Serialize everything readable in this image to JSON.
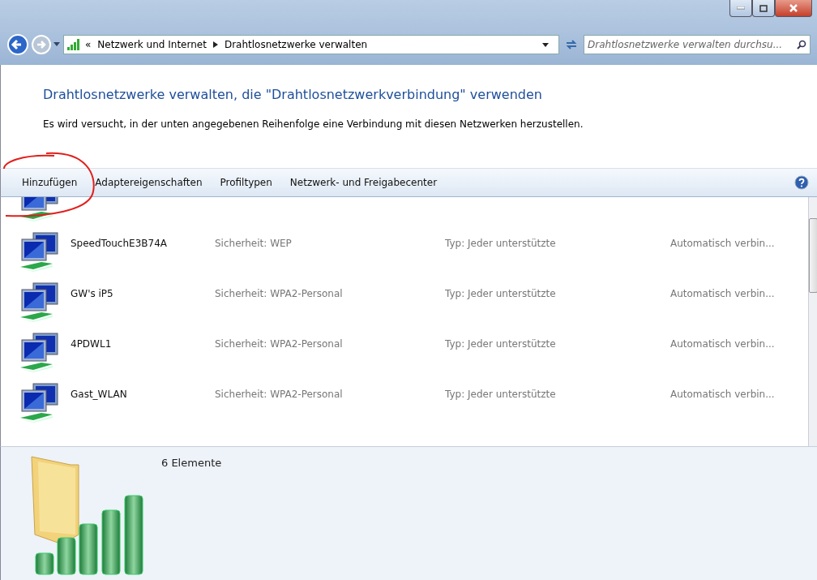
{
  "address_bar": {
    "overflow": "«",
    "breadcrumbs": [
      "Netzwerk und Internet",
      "Drahtlosnetzwerke verwalten"
    ],
    "search_placeholder": "Drahtlosnetzwerke verwalten durchsu..."
  },
  "header": {
    "title": "Drahtlosnetzwerke verwalten, die \"Drahtlosnetzwerkverbindung\" verwenden",
    "description": "Es wird versucht, in der unten angegebenen Reihenfolge eine Verbindung mit diesen Netzwerken herzustellen."
  },
  "toolbar": [
    "Hinzufügen",
    "Adaptereigenschaften",
    "Profiltypen",
    "Netzwerk- und Freigabecenter"
  ],
  "networks": [
    {
      "name": "SpeedTouchE3B74A",
      "security": "Sicherheit: WEP",
      "type": "Typ: Jeder unterstützte",
      "mode": "Automatisch verbin..."
    },
    {
      "name": "GW's iP5",
      "security": "Sicherheit: WPA2-Personal",
      "type": "Typ: Jeder unterstützte",
      "mode": "Automatisch verbin..."
    },
    {
      "name": "4PDWL1",
      "security": "Sicherheit: WPA2-Personal",
      "type": "Typ: Jeder unterstützte",
      "mode": "Automatisch verbin..."
    },
    {
      "name": "Gast_WLAN",
      "security": "Sicherheit: WPA2-Personal",
      "type": "Typ: Jeder unterstützte",
      "mode": "Automatisch verbin..."
    }
  ],
  "details": {
    "count": "6 Elemente"
  }
}
